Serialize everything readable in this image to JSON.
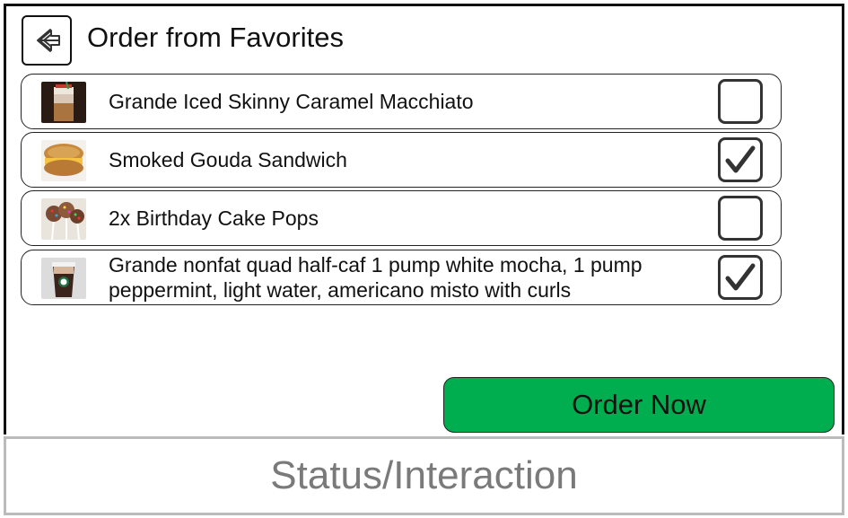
{
  "header": {
    "title": "Order from Favorites",
    "back_icon": "back-arrow-icon"
  },
  "favorites": [
    {
      "label": "Grande Iced Skinny Caramel Macchiato",
      "checked": false,
      "thumb": "iced-drink"
    },
    {
      "label": "Smoked Gouda Sandwich",
      "checked": true,
      "thumb": "sandwich"
    },
    {
      "label": "2x Birthday Cake Pops",
      "checked": false,
      "thumb": "cake-pops"
    },
    {
      "label": "Grande nonfat quad half-caf 1 pump white mocha, 1 pump peppermint, light water, americano misto with curls",
      "checked": true,
      "thumb": "coffee-cup"
    }
  ],
  "actions": {
    "order_label": "Order Now"
  },
  "status": {
    "text": "Status/Interaction"
  },
  "colors": {
    "accent": "#00ad4f",
    "border": "#222222",
    "status_text": "#7a7a7a"
  }
}
